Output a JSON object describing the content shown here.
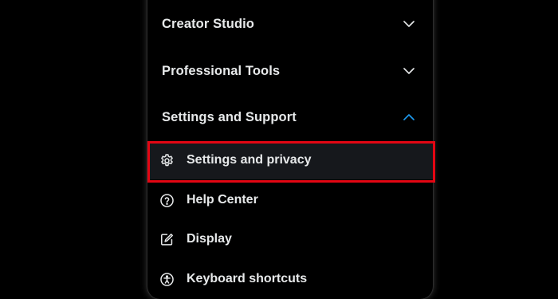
{
  "menu": {
    "sections": [
      {
        "title": "Creator Studio",
        "expanded": false
      },
      {
        "title": "Professional Tools",
        "expanded": false
      },
      {
        "title": "Settings and Support",
        "expanded": true
      }
    ],
    "items": [
      {
        "label": "Settings and privacy",
        "icon": "gear-icon",
        "highlighted": true
      },
      {
        "label": "Help Center",
        "icon": "help-circle-icon",
        "highlighted": false
      },
      {
        "label": "Display",
        "icon": "edit-square-icon",
        "highlighted": false
      },
      {
        "label": "Keyboard shortcuts",
        "icon": "accessibility-icon",
        "highlighted": false
      }
    ]
  },
  "colors": {
    "background": "#000000",
    "text": "#e7e9ea",
    "accent": "#1d9bf0",
    "highlight_border": "#e30613",
    "active_row": "#16181c"
  }
}
